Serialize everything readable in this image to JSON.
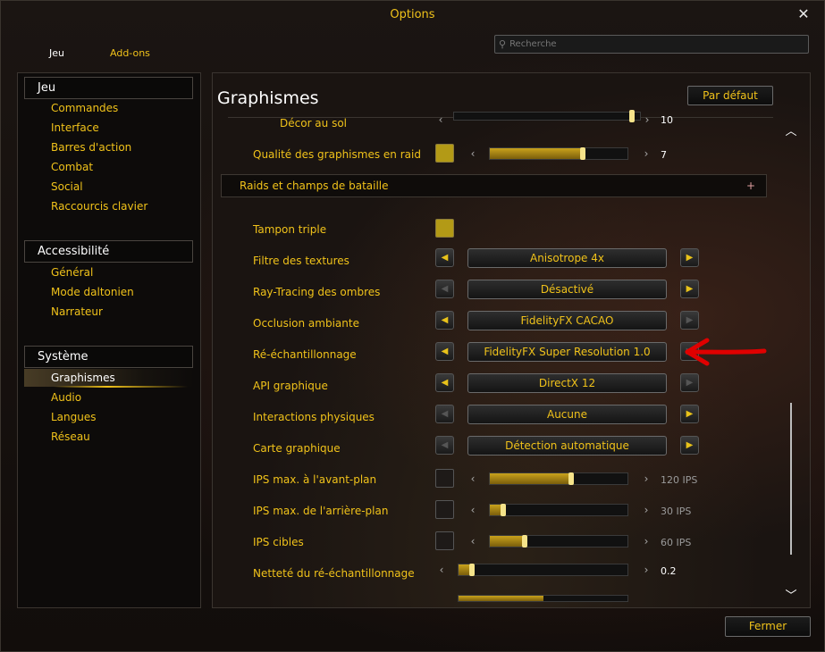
{
  "window": {
    "title": "Options",
    "close_symbol": "✕",
    "tabs": [
      "Jeu",
      "Add-ons"
    ],
    "search_placeholder": "Recherche"
  },
  "sidebar": {
    "categories": [
      {
        "header": "Jeu",
        "items": [
          "Commandes",
          "Interface",
          "Barres d'action",
          "Combat",
          "Social",
          "Raccourcis clavier"
        ]
      },
      {
        "header": "Accessibilité",
        "items": [
          "Général",
          "Mode daltonien",
          "Narrateur"
        ]
      },
      {
        "header": "Système",
        "items": [
          "Graphismes",
          "Audio",
          "Langues",
          "Réseau"
        ]
      }
    ],
    "selected": "Graphismes"
  },
  "main": {
    "title": "Graphismes",
    "default_button": "Par défaut",
    "close_button": "Fermer",
    "subsection": "Raids et champs de bataille",
    "subsection_icon": "+",
    "rows": {
      "decor": {
        "label": "Décor au sol",
        "value": "10",
        "level": 1.0
      },
      "raid_quality": {
        "label": "Qualité des graphismes en raid",
        "value": "7",
        "level": 0.67,
        "checked": true
      },
      "triple_buffer": {
        "label": "Tampon triple",
        "checked": true
      },
      "texture_filter": {
        "label": "Filtre des textures",
        "value": "Anisotrope 4x"
      },
      "raytracing": {
        "label": "Ray-Tracing des ombres",
        "value": "Désactivé"
      },
      "ambient_occlusion": {
        "label": "Occlusion ambiante",
        "value": "FidelityFX CACAO"
      },
      "resampling": {
        "label": "Ré-échantillonnage",
        "value": "FidelityFX Super Resolution 1.0"
      },
      "graphics_api": {
        "label": "API graphique",
        "value": "DirectX 12"
      },
      "physics": {
        "label": "Interactions physiques",
        "value": "Aucune"
      },
      "graphics_card": {
        "label": "Carte graphique",
        "value": "Détection automatique"
      },
      "fps_foreground": {
        "label": "IPS max. à l'avant-plan",
        "value": "120 IPS",
        "level": 0.58,
        "checked": false
      },
      "fps_background": {
        "label": "IPS max. de l'arrière-plan",
        "value": "30 IPS",
        "level": 0.1,
        "checked": false
      },
      "fps_target": {
        "label": "IPS cibles",
        "value": "60 IPS",
        "level": 0.25,
        "checked": false
      },
      "sharpness": {
        "label": "Netteté du ré-échantillonnage",
        "value": "0.2",
        "level": 0.07
      }
    }
  },
  "colors": {
    "accent": "#f0c21a",
    "annotation": "#e00000"
  }
}
